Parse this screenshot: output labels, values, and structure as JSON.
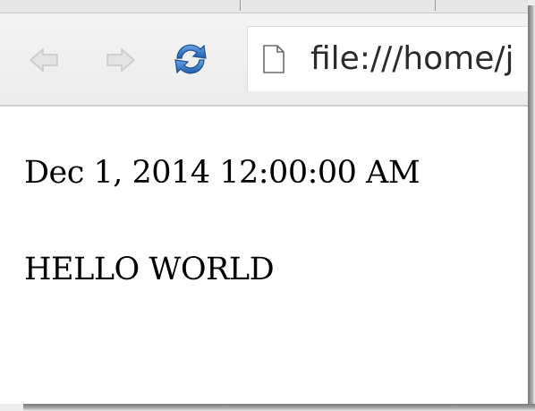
{
  "browser": {
    "toolbar": {
      "back_icon": "back-arrow-icon",
      "forward_icon": "forward-arrow-icon",
      "reload_icon": "reload-icon"
    },
    "address_bar": {
      "icon": "page-icon",
      "value": "file:///home/j"
    }
  },
  "page": {
    "lines": [
      "Dec 1, 2014 12:00:00 AM",
      "HELLO WORLD"
    ]
  },
  "colors": {
    "disabled_icon": "#cfcfcf",
    "reload_blue": "#2e74c4",
    "text": "#000000"
  }
}
